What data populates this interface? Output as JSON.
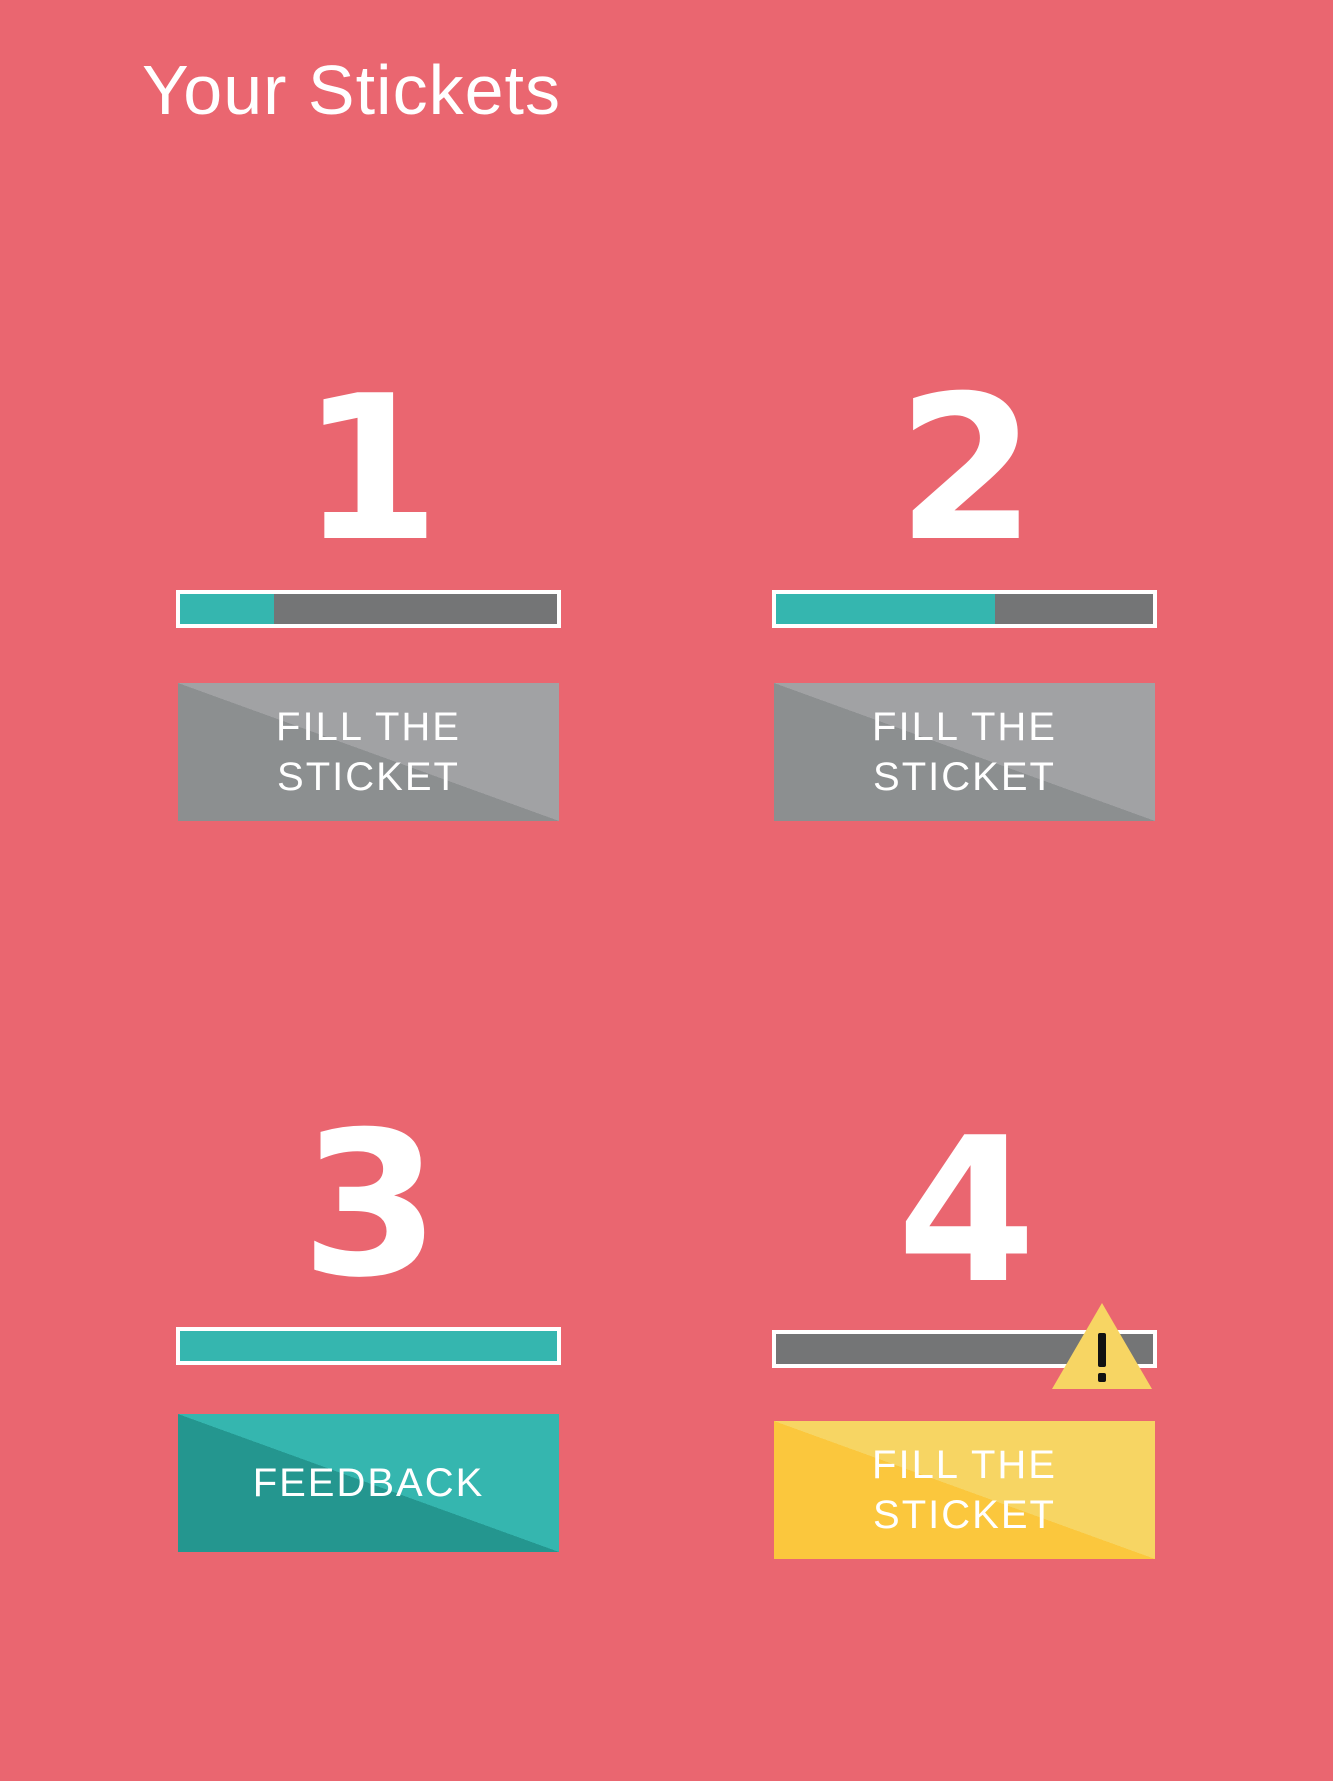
{
  "header": {
    "title": "Your Stickets"
  },
  "stickets": [
    {
      "number": "1",
      "progress": 0.25,
      "button_label": "FILL THE\nSTICKET",
      "button_style": "gray"
    },
    {
      "number": "2",
      "progress": 0.58,
      "button_label": "FILL THE\nSTICKET",
      "button_style": "gray"
    },
    {
      "number": "3",
      "progress": 1.0,
      "button_label": "FEEDBACK",
      "button_style": "teal"
    },
    {
      "number": "4",
      "progress": 0.0,
      "button_label": "FILL THE\nSTICKET",
      "button_style": "yellow",
      "warning": true,
      "warning_icon": "warning-icon"
    }
  ],
  "colors": {
    "background": "#EA6670",
    "progress_fill": "#35B6AF",
    "progress_track": "#747576",
    "button_gray": "#A1A2A4",
    "button_teal": "#35B6AF",
    "button_yellow": "#FBC73D",
    "warning": "#F7D563"
  }
}
